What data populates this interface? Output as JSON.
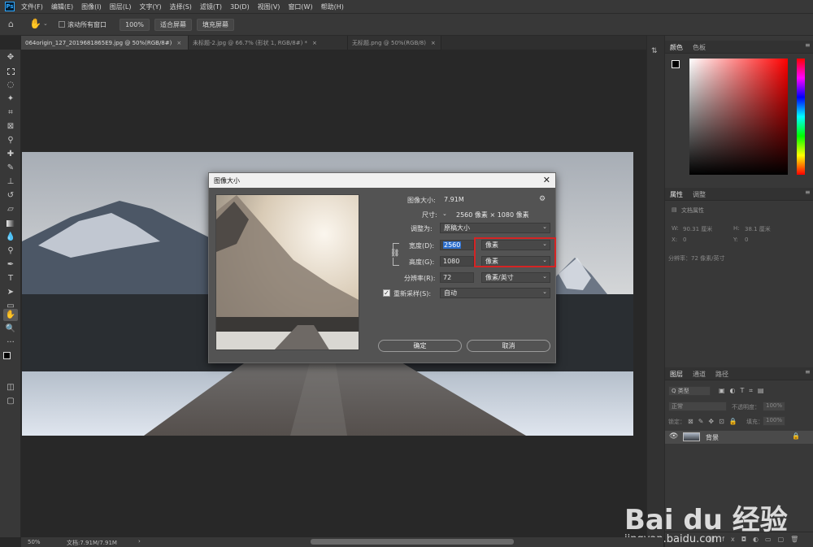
{
  "menubar": {
    "logo": "Ps",
    "items": [
      "文件(F)",
      "编辑(E)",
      "图像(I)",
      "图层(L)",
      "文字(Y)",
      "选择(S)",
      "滤镜(T)",
      "3D(D)",
      "视图(V)",
      "窗口(W)",
      "帮助(H)"
    ]
  },
  "options": {
    "scroll_all_windows": "滚动所有窗口",
    "zoom": "100%",
    "fit_screen": "适合屏幕",
    "fill_screen": "填充屏幕"
  },
  "tabs": [
    {
      "label": "064origin_127_2019681865E9.jpg @ 50%(RGB/8#)",
      "close": "×"
    },
    {
      "label": "未标题-2.jpg @ 66.7% (形状 1, RGB/8#) *",
      "close": "×"
    },
    {
      "label": "无标题.png @ 50%(RGB/8)",
      "close": "×"
    }
  ],
  "status": {
    "zoom": "50%",
    "doc": "文档:7.91M/7.91M",
    "arrow": "›"
  },
  "dialog": {
    "title": "图像大小",
    "close": "✕",
    "image_size_label": "图像大小:",
    "image_size_value": "7.91M",
    "dimensions_label": "尺寸:",
    "dimensions_value": "2560 像素 × 1080 像素",
    "fit_to_label": "调整为:",
    "fit_to_value": "原稿大小",
    "width_label": "宽度(D):",
    "width_value": "2560",
    "width_unit": "像素",
    "height_label": "高度(G):",
    "height_value": "1080",
    "height_unit": "像素",
    "resolution_label": "分辨率(R):",
    "resolution_value": "72",
    "resolution_unit": "像素/英寸",
    "resample_label": "重新采样(S):",
    "resample_value": "自动",
    "ok": "确定",
    "cancel": "取消"
  },
  "panels": {
    "color_tab": "颜色",
    "swatches_tab": "色板",
    "properties_tab": "属性",
    "adjust_tab": "调整",
    "doc_props": "文档属性",
    "w_label": "W:",
    "w_value": "90.31 厘米",
    "h_label": "H:",
    "h_value": "38.1 厘米",
    "x_label": "X:",
    "x_value": "0",
    "y_label": "Y:",
    "y_value": "0",
    "resolution_text": "分辨率：72 像素/英寸",
    "layers_tab": "图层",
    "channels_tab": "通道",
    "paths_tab": "路径",
    "kind_label": "Q 类型",
    "blend_mode": "正常",
    "opacity_label": "不透明度：",
    "opacity_value": "100%",
    "lock_label": "锁定：",
    "fill_label": "填充：",
    "fill_value": "100%",
    "layer_name": "背景"
  },
  "watermark": {
    "brand": "Bai du 经验",
    "url": "jingyan.baidu.com"
  },
  "colors": {
    "highlight": "#d52424",
    "selection": "#2d6fce",
    "ps_blue": "#31a8ff"
  }
}
